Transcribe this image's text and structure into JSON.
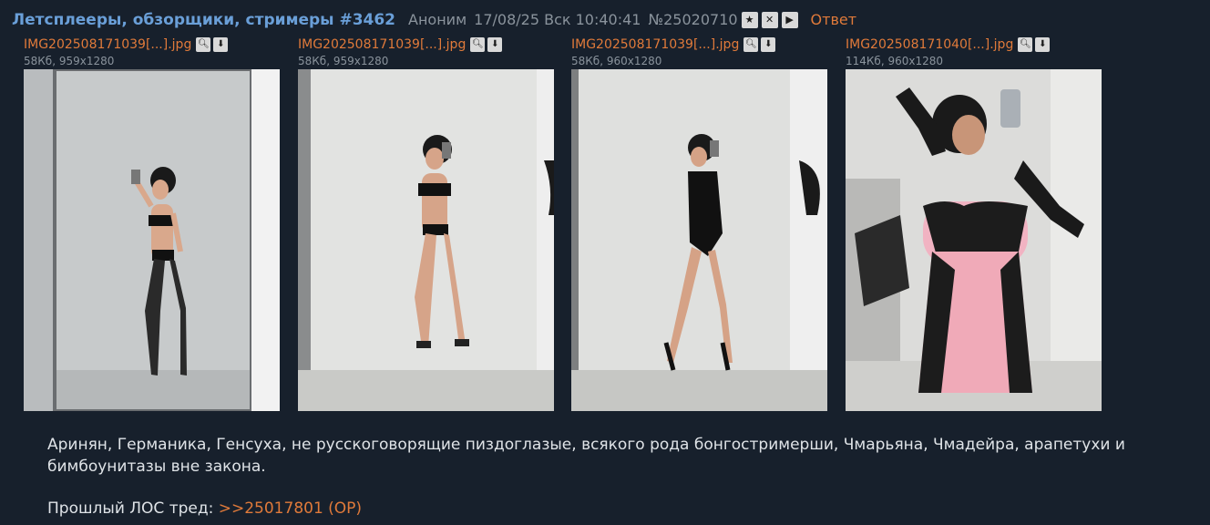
{
  "post": {
    "title": "Летсплееры, обзорщики, стримеры #3462",
    "author": "Аноним",
    "date": "17/08/25 Вск 10:40:41",
    "number": "№25020710",
    "reply_label": "Ответ",
    "icons": [
      "star-icon",
      "close-icon",
      "play-icon"
    ]
  },
  "files": [
    {
      "name": "IMG202508171039[...].jpg",
      "meta": "58Кб, 959x1280"
    },
    {
      "name": "IMG202508171039[...].jpg",
      "meta": "58Кб, 959x1280"
    },
    {
      "name": "IMG202508171039[...].jpg",
      "meta": "58Кб, 960x1280"
    },
    {
      "name": "IMG202508171040[...].jpg",
      "meta": "114Кб, 960x1280"
    }
  ],
  "body": {
    "line1": "Аринян, Германика, Генсуха, не русскоговорящие пиздоглазые, всякого рода бонгостримерши, Чмарьяна, Чмадейра, арапетухи и бимбоунитазы вне закона.",
    "prev_label": "Прошлый ЛОС тред: ",
    "prev_link": ">>25017801 (OP)"
  },
  "colors": {
    "background": "#17202c",
    "title": "#6a9fd8",
    "link": "#e07a3a",
    "muted": "#8a939c"
  }
}
